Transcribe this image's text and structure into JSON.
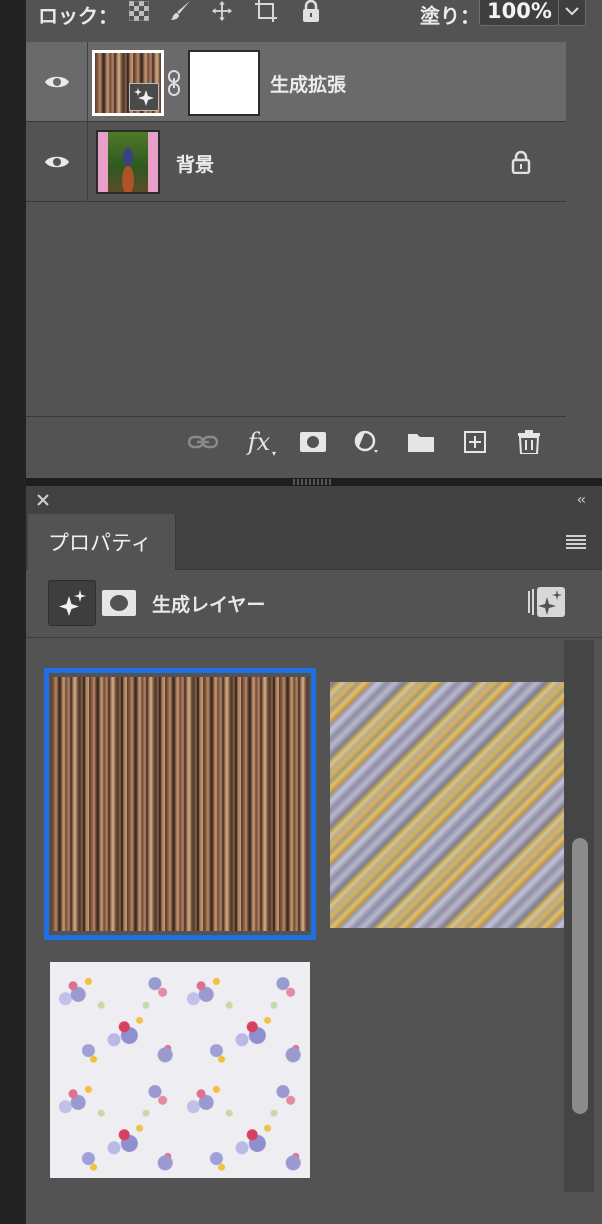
{
  "layers_panel": {
    "lock_label": "ロック：",
    "fill_label": "塗り：",
    "fill_value": "100%",
    "layers": [
      {
        "name": "生成拡張",
        "visible": true,
        "selected": true,
        "has_mask": true,
        "locked": false
      },
      {
        "name": "背景",
        "visible": true,
        "selected": false,
        "has_mask": false,
        "locked": true
      }
    ],
    "footer_icons": [
      "link-icon",
      "fx-icon",
      "add-mask-icon",
      "adjustment-icon",
      "folder-icon",
      "new-layer-icon",
      "trash-icon"
    ]
  },
  "properties_panel": {
    "tab_label": "プロパティ",
    "header_title": "生成レイヤー",
    "variations": [
      {
        "name": "stripes",
        "selected": true
      },
      {
        "name": "diagonal",
        "selected": false
      },
      {
        "name": "floral",
        "selected": false
      }
    ],
    "colors": {
      "selection": "#1f6fe0",
      "panel": "#535353"
    }
  }
}
